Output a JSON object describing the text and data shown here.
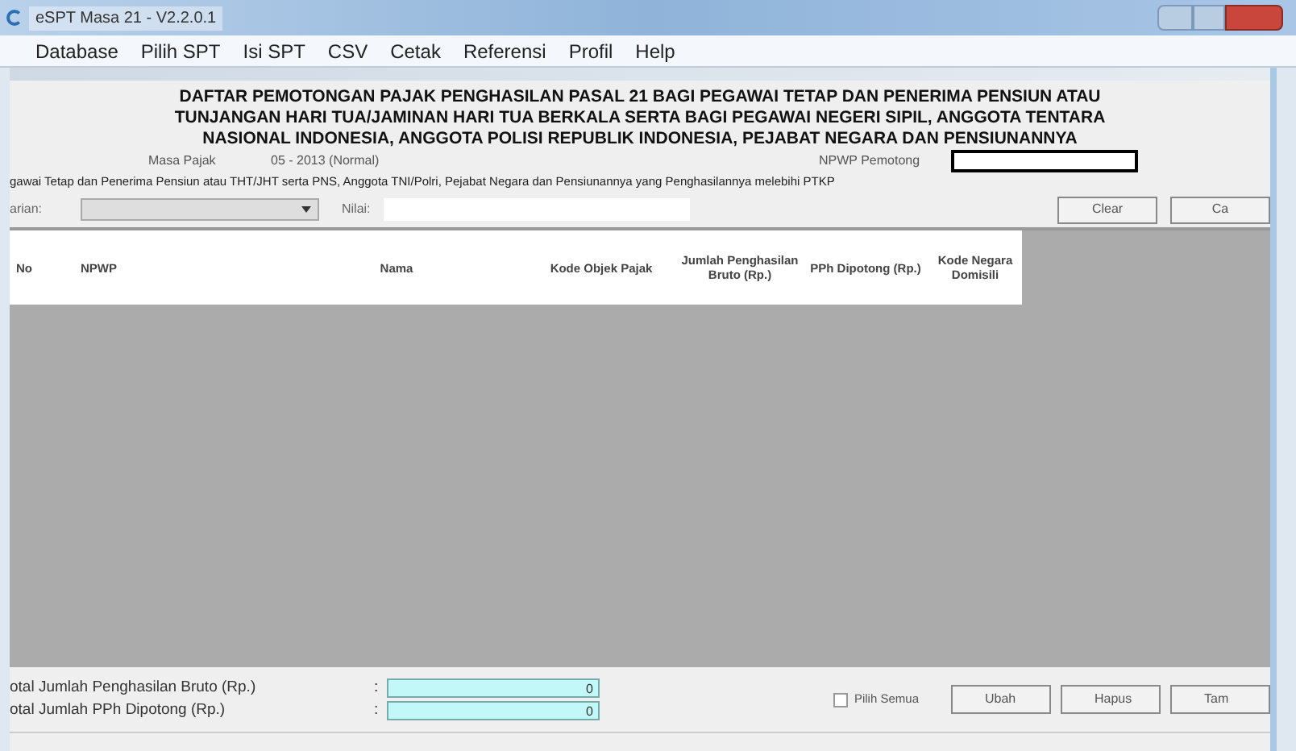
{
  "window": {
    "title": "eSPT Masa 21 - V2.2.0.1"
  },
  "menu": [
    "Database",
    "Pilih SPT",
    "Isi SPT",
    "CSV",
    "Cetak",
    "Referensi",
    "Profil",
    "Help"
  ],
  "heading": [
    "DAFTAR PEMOTONGAN PAJAK PENGHASILAN PASAL 21 BAGI PEGAWAI TETAP DAN PENERIMA PENSIUN ATAU",
    "TUNJANGAN HARI TUA/JAMINAN HARI TUA BERKALA SERTA BAGI PEGAWAI NEGERI SIPIL, ANGGOTA TENTARA",
    "NASIONAL INDONESIA, ANGGOTA POLISI REPUBLIK INDONESIA, PEJABAT NEGARA DAN PENSIUNANNYA"
  ],
  "masa_pajak": {
    "label": "Masa Pajak",
    "value": "05 - 2013 (Normal)"
  },
  "npwp_pemotong": {
    "label": "NPWP Pemotong"
  },
  "description": "gawai Tetap dan Penerima Pensiun atau THT/JHT serta PNS, Anggota TNI/Polri, Pejabat Negara dan Pensiunannya yang Penghasilannya melebihi PTKP",
  "filter": {
    "label": "arian:",
    "value_label": "Nilai:"
  },
  "filter_buttons": [
    "Clear",
    "Ca"
  ],
  "table": {
    "columns": [
      "No",
      "NPWP",
      "Nama",
      "Kode Objek Pajak",
      "Jumlah Penghasilan Bruto (Rp.)",
      "PPh Dipotong (Rp.)",
      "Kode Negara Domisili"
    ]
  },
  "totals": [
    {
      "label": "otal Jumlah Penghasilan Bruto (Rp.)",
      "separator": ":",
      "value": "0"
    },
    {
      "label": "otal Jumlah PPh Dipotong (Rp.)",
      "separator": ":",
      "value": "0"
    }
  ],
  "select_all": {
    "label": "Pilih Semua",
    "checked": false
  },
  "buttons": [
    "Ubah",
    "Hapus",
    "Tam"
  ]
}
